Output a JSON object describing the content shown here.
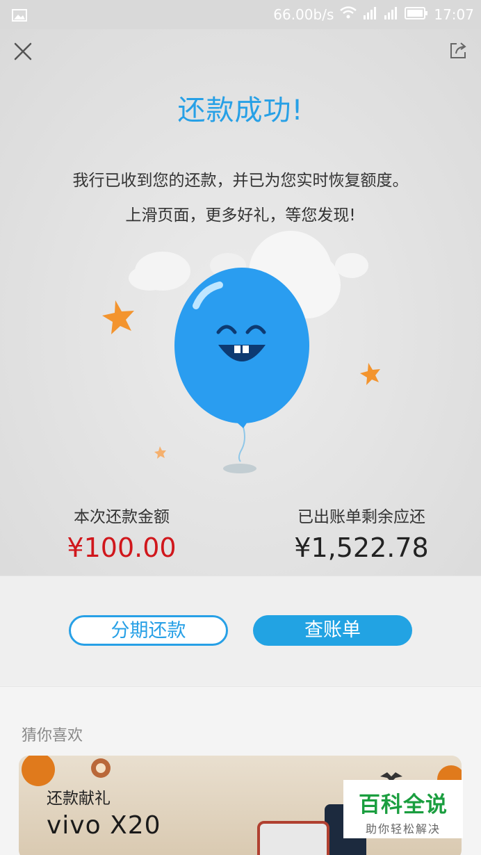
{
  "status_bar": {
    "speed": "66.00b/s",
    "time": "17:07",
    "icons": [
      "image-icon",
      "wifi-icon",
      "signal-icon",
      "signal-icon",
      "battery-icon"
    ]
  },
  "header": {
    "close_icon": "close-icon",
    "share_icon": "share-icon"
  },
  "result": {
    "title": "还款成功!",
    "message_line1": "我行已收到您的还款，并已为您实时恢复额度。",
    "message_line2": "上滑页面，更多好礼，等您发现!"
  },
  "amounts": {
    "paid_label": "本次还款金额",
    "paid_value": "¥100.00",
    "remaining_label": "已出账单剩余应还",
    "remaining_value": "¥1,522.78"
  },
  "actions": {
    "installment_label": "分期还款",
    "bill_label": "查账单"
  },
  "recommend": {
    "title": "猜你喜欢",
    "promo_sub": "还款献礼",
    "promo_main": "vivo  X20"
  },
  "watermark": {
    "main": "百科全说",
    "sub": "助你轻松解决"
  },
  "colors": {
    "accent": "#27a0e6",
    "amount_red": "#d0171c",
    "balloon": "#2a9df0"
  }
}
